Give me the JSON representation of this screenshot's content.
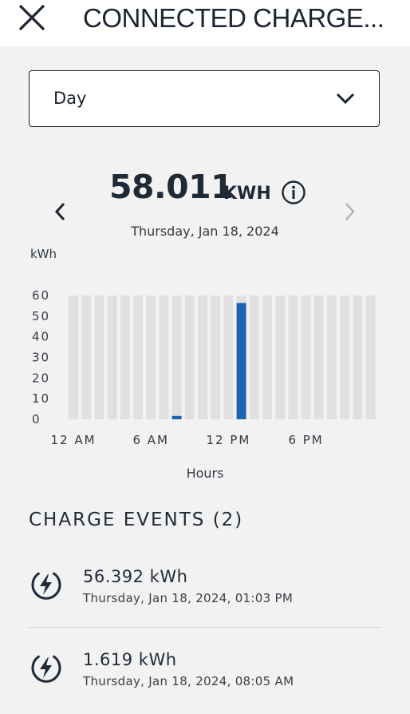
{
  "header": {
    "title": "CONNECTED CHARGE...",
    "close_icon": "close-icon"
  },
  "period_select": {
    "value": "Day",
    "icon": "chevron-down-icon"
  },
  "summary": {
    "total_value": "58.011",
    "total_unit": "KWH",
    "date": "Thursday, Jan 18, 2024",
    "prev_icon": "chevron-left-icon",
    "next_icon": "chevron-right-icon",
    "info_icon": "info-icon"
  },
  "chart_data": {
    "type": "bar",
    "ylabel": "kWh",
    "xlabel": "Hours",
    "ylim": [
      0,
      60
    ],
    "yticks": [
      "60",
      "50",
      "40",
      "30",
      "20",
      "10",
      "0"
    ],
    "xticks": [
      {
        "label": "12 AM",
        "hour": 0
      },
      {
        "label": "6 AM",
        "hour": 6
      },
      {
        "label": "12 PM",
        "hour": 12
      },
      {
        "label": "6 PM",
        "hour": 18
      }
    ],
    "hours": [
      0,
      1,
      2,
      3,
      4,
      5,
      6,
      7,
      8,
      9,
      10,
      11,
      12,
      13,
      14,
      15,
      16,
      17,
      18,
      19,
      20,
      21,
      22,
      23
    ],
    "values": [
      0,
      0,
      0,
      0,
      0,
      0,
      0,
      0,
      1.619,
      0,
      0,
      0,
      0,
      56.392,
      0,
      0,
      0,
      0,
      0,
      0,
      0,
      0,
      0,
      0
    ],
    "background_bar_color": "#e0e0e0",
    "bar_color": "#1b63b8"
  },
  "events": {
    "title": "CHARGE EVENTS (2)",
    "items": [
      {
        "amount": "56.392 kWh",
        "time": "Thursday, Jan 18, 2024, 01:03 PM",
        "icon": "charging-bolt-icon"
      },
      {
        "amount": "1.619 kWh",
        "time": "Thursday, Jan 18, 2024, 08:05 AM",
        "icon": "charging-bolt-icon"
      }
    ]
  }
}
